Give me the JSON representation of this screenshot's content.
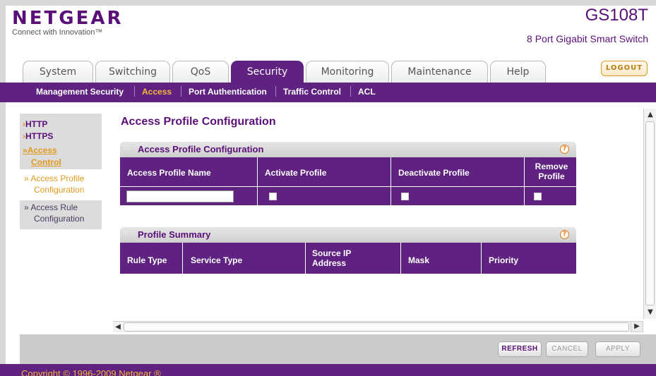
{
  "brand": {
    "logo": "NETGEAR",
    "tagline": "Connect with Innovation™",
    "model": "GS108T",
    "model_desc": "8 Port Gigabit Smart Switch"
  },
  "tabs": [
    {
      "label": "System",
      "active": false
    },
    {
      "label": "Switching",
      "active": false
    },
    {
      "label": "QoS",
      "active": false
    },
    {
      "label": "Security",
      "active": true
    },
    {
      "label": "Monitoring",
      "active": false
    },
    {
      "label": "Maintenance",
      "active": false
    },
    {
      "label": "Help",
      "active": false
    }
  ],
  "logout_label": "LOGOUT",
  "subnav": [
    {
      "label": "Management Security",
      "active": false
    },
    {
      "label": "Access",
      "active": true
    },
    {
      "label": "Port Authentication",
      "active": false
    },
    {
      "label": "Traffic Control",
      "active": false
    },
    {
      "label": "ACL",
      "active": false
    }
  ],
  "sidebar": {
    "items": [
      {
        "marker": "›",
        "label": "HTTP"
      },
      {
        "marker": "›",
        "label": "HTTPS"
      },
      {
        "marker": "»",
        "label": "Access"
      },
      {
        "marker": "",
        "label": "Control"
      }
    ],
    "subitems": [
      {
        "label": "» Access Profile",
        "label2": "Configuration",
        "active": true
      },
      {
        "label": "» Access Rule",
        "label2": "Configuration",
        "active": false
      }
    ]
  },
  "page_title": "Access Profile Configuration",
  "profile_section": {
    "title": "Access Profile Configuration",
    "columns": [
      "Access Profile Name",
      "Activate Profile",
      "Deactivate Profile",
      "Remove",
      "Profile"
    ],
    "row": {
      "name_value": "",
      "activate": false,
      "deactivate": false,
      "remove": false
    }
  },
  "summary_section": {
    "title": "Profile Summary",
    "columns": [
      "Rule Type",
      "Service Type",
      "Source IP",
      "Address",
      "Mask",
      "Priority"
    ]
  },
  "help_glyph": "?",
  "section_dots": "::",
  "buttons": {
    "refresh": "REFRESH",
    "cancel": "CANCEL",
    "apply": "APPLY"
  },
  "footer": "Copyright © 1996-2009 Netgear ®",
  "colors": {
    "brand_purple": "#5f2280",
    "accent_orange": "#f4b63b"
  }
}
